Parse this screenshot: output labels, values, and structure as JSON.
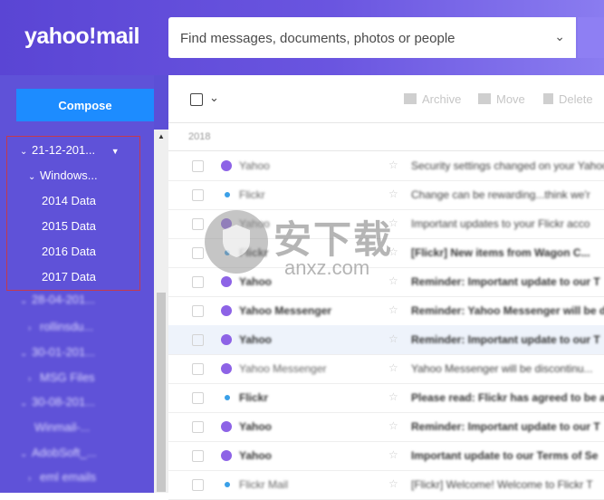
{
  "header": {
    "logo": "yahoo!mail",
    "search_placeholder": "Find messages, documents, photos or people",
    "search_chevron": "chevron-down-icon"
  },
  "sidebar": {
    "compose_label": "Compose",
    "folders": [
      {
        "label": "21-12-201...",
        "expanded": true
      },
      {
        "label": "Windows...",
        "expanded": true
      },
      {
        "label": "2014 Data"
      },
      {
        "label": "2015 Data"
      },
      {
        "label": "2016 Data"
      },
      {
        "label": "2017 Data"
      },
      {
        "label": "28-04-201...",
        "expanded": true
      },
      {
        "label": "rollinsdu..."
      },
      {
        "label": "30-01-201...",
        "expanded": true
      },
      {
        "label": "MSG Files"
      },
      {
        "label": "30-08-201...",
        "expanded": true
      },
      {
        "label": "Winmail-..."
      },
      {
        "label": "AdobSoft_...",
        "expanded": true
      },
      {
        "label": "eml emails"
      }
    ]
  },
  "toolbar": {
    "archive": "Archive",
    "move": "Move",
    "delete": "Delete"
  },
  "list": {
    "year": "2018",
    "messages": [
      {
        "from": "Yahoo",
        "subject": "Security settings changed on your Yahoo",
        "avatar": "purple",
        "bold": false
      },
      {
        "from": "Flickr",
        "subject": "Change can be rewarding...think we'r",
        "avatar": "blue",
        "bold": false
      },
      {
        "from": "Yahoo",
        "subject": "Important updates to your Flickr acco",
        "avatar": "purple",
        "bold": false
      },
      {
        "from": "Flickr",
        "subject": "[Flickr] New items from Wagon C...",
        "avatar": "blue",
        "bold": true
      },
      {
        "from": "Yahoo",
        "subject": "Reminder: Important update to our T",
        "avatar": "purple",
        "bold": true
      },
      {
        "from": "Yahoo Messenger",
        "subject": "Reminder: Yahoo Messenger will be d",
        "avatar": "purple",
        "bold": true
      },
      {
        "from": "Yahoo",
        "subject": "Reminder: Important update to our T",
        "avatar": "purple",
        "bold": true
      },
      {
        "from": "Yahoo Messenger",
        "subject": "Yahoo Messenger will be discontinu...",
        "avatar": "purple",
        "bold": false
      },
      {
        "from": "Flickr",
        "subject": "Please read: Flickr has agreed to be a",
        "avatar": "blue",
        "bold": true
      },
      {
        "from": "Yahoo",
        "subject": "Reminder: Important update to our T",
        "avatar": "purple",
        "bold": true
      },
      {
        "from": "Yahoo",
        "subject": "Important update to our Terms of Se",
        "avatar": "purple",
        "bold": true
      },
      {
        "from": "Flickr Mail",
        "subject": "[Flickr] Welcome! Welcome to Flickr T",
        "avatar": "blue",
        "bold": false
      }
    ]
  },
  "watermark": {
    "cn": "安下载",
    "en": "anxz.com"
  },
  "colors": {
    "header": "#5a45d4",
    "sidebar": "#5f52d8",
    "compose": "#1d8cff",
    "highlight_border": "#c43a4d"
  }
}
